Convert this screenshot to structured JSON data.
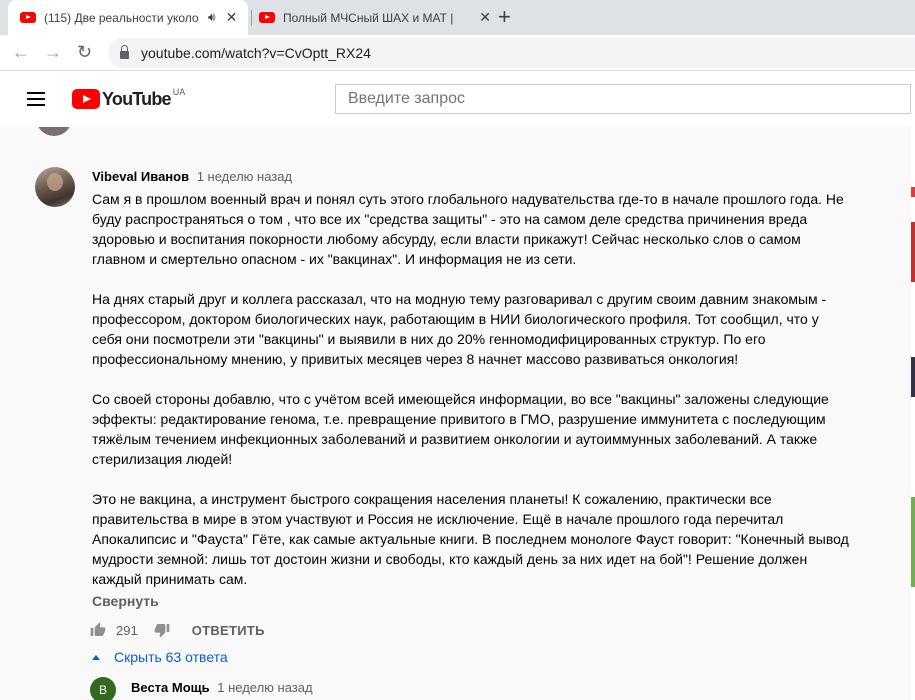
{
  "browser": {
    "tabs": [
      {
        "title": "(115) Две реальности уколо",
        "active": true,
        "audio": true
      },
      {
        "title": "Полный МЧСный ШАХ и МАТ | ",
        "active": false,
        "audio": false
      }
    ],
    "new_tab_symbol": "+",
    "url": "youtube.com/watch?v=CvOptt_RX24"
  },
  "youtube": {
    "logo_text": "YouTube",
    "country_code": "UA",
    "search_placeholder": "Введите запрос"
  },
  "comment": {
    "author": "Vibeval Иванов",
    "time": "1 неделю назад",
    "paragraphs": [
      "Сам я в прошлом военный врач и понял суть этого глобального надувательства где-то в начале прошлого года. Не буду распространяться о том , что все их \"средства защиты\" - это на самом деле средства причинения вреда здоровью и воспитания покорности любому абсурду, если власти прикажут! Сейчас несколько слов о самом главном и смертельно опасном - их \"вакцинах\". И информация не из сети.",
      "На днях старый друг и коллега рассказал, что на модную тему разговаривал с другим своим давним знакомым - профессором, доктором биологических наук, работающим в НИИ биологического профиля. Тот сообщил, что у себя они посмотрели эти \"вакцины\" и выявили в них до 20% генномодифицированных структур. По его профессиональному мнению, у привитых месяцев через 8 начнет массово развиваться онкология!",
      "Со своей стороны добавлю, что с учётом всей имеющейся информации, во все \"вакцины\" заложены следующие эффекты: редактирование генома, т.е. превращение привитого в ГМО, разрушение иммунитета с последующим тяжёлым течением инфекционных заболеваний и развитием онкологии и аутоиммунных заболеваний. А также стерилизация людей!",
      "Это не вакцина, а инструмент быстрого сокращения населения планеты! К сожалению, практически все правительства в мире в этом участвуют и Россия не исключение. Ещё в начале прошлого года перечитал Апокалипсис и \"Фауста\" Гёте, как самые актуальные книги. В последнем монологе Фауст  говорит: \"Конечный вывод мудрости земной: лишь тот достоин жизни и свободы, кто каждый день за них идет на бой\"! Решение должен каждый принимать сам."
    ],
    "collapse_label": "Свернуть",
    "likes": "291",
    "reply_label": "ОТВЕТИТЬ",
    "hide_replies_label": "Скрыть 63 ответа"
  },
  "reply": {
    "avatar_letter": "В",
    "author": "Веста Мощь",
    "time": "1 неделю назад",
    "avatar_color": "#33691e"
  },
  "colors": {
    "accent_link": "#065fd4",
    "brand_red": "#ff0000",
    "secondary_text": "#606060"
  }
}
